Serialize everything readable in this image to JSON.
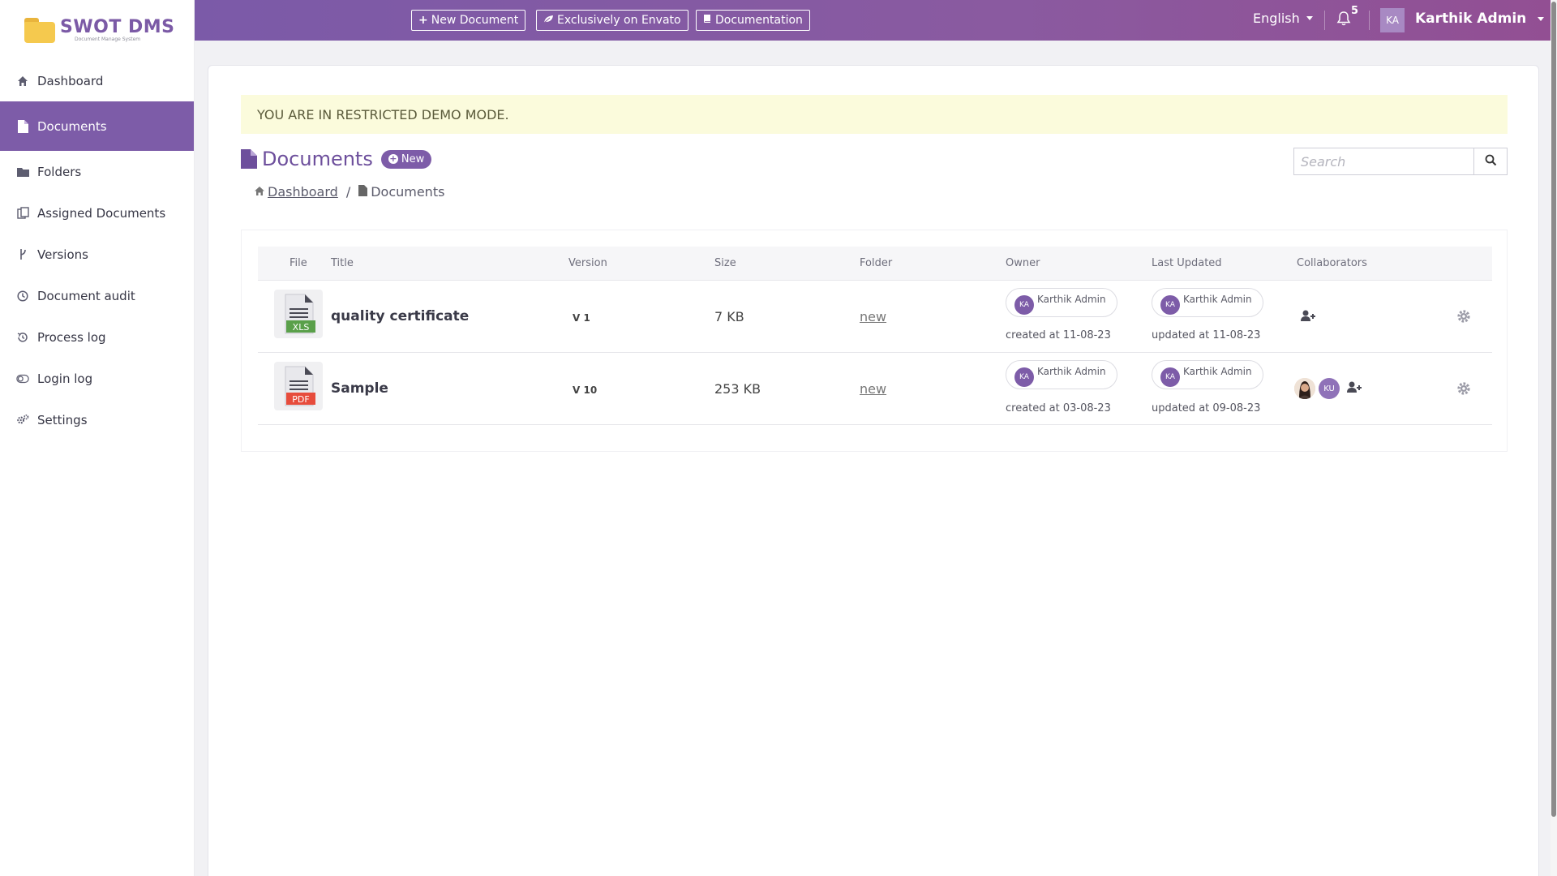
{
  "app": {
    "logo_title": "SWOT DMS",
    "logo_subtitle": "Document Manage System"
  },
  "colors": {
    "primary": "#7d5ca8",
    "topbar_start": "#7b5aa8",
    "topbar_end": "#924f93",
    "alert_bg": "#fbfbdc"
  },
  "sidebar": {
    "items": [
      {
        "label": "Dashboard",
        "icon": "home-icon",
        "active": false
      },
      {
        "label": "Documents",
        "icon": "file-icon",
        "active": true
      },
      {
        "label": "Folders",
        "icon": "folder-icon",
        "active": false
      },
      {
        "label": "Assigned Documents",
        "icon": "assigned-documents-icon",
        "active": false
      },
      {
        "label": "Versions",
        "icon": "branch-icon",
        "active": false
      },
      {
        "label": "Document audit",
        "icon": "clock-icon",
        "active": false
      },
      {
        "label": "Process log",
        "icon": "history-icon",
        "active": false
      },
      {
        "label": "Login log",
        "icon": "toggle-icon",
        "active": false
      },
      {
        "label": "Settings",
        "icon": "cogs-icon",
        "active": false
      }
    ]
  },
  "topbar": {
    "new_document": "New Document",
    "envato": "Exclusively on Envato",
    "documentation": "Documentation",
    "language": "English",
    "notifications_count": "5",
    "user_initials": "KA",
    "user_name": "Karthik Admin"
  },
  "alert": {
    "text": "YOU ARE IN RESTRICTED DEMO MODE."
  },
  "page": {
    "title": "Documents",
    "new_label": "New",
    "search_placeholder": "Search"
  },
  "breadcrumb": {
    "home": "Dashboard",
    "current": "Documents",
    "separator": "/"
  },
  "table": {
    "headers": {
      "file": "File",
      "title": "Title",
      "version": "Version",
      "size": "Size",
      "folder": "Folder",
      "owner": "Owner",
      "last_updated": "Last Updated",
      "collaborators": "Collaborators"
    },
    "rows": [
      {
        "file_type": "XLS",
        "file_color": "#5aa04a",
        "title": "quality certificate",
        "version": "V 1",
        "size": "7 KB",
        "folder": "new",
        "owner_initials": "KA",
        "owner_name": "Karthik Admin",
        "created": "created at 11-08-23",
        "updater_initials": "KA",
        "updater_name": "Karthik Admin",
        "updated": "updated at 11-08-23"
      },
      {
        "file_type": "PDF",
        "file_color": "#e74c3c",
        "title": "Sample",
        "version": "V 10",
        "size": "253 KB",
        "folder": "new",
        "owner_initials": "KA",
        "owner_name": "Karthik Admin",
        "created": "created at 03-08-23",
        "updater_initials": "KA",
        "updater_name": "Karthik Admin",
        "updated": "updated at 09-08-23",
        "collaborator_initials": "KU"
      }
    ]
  }
}
